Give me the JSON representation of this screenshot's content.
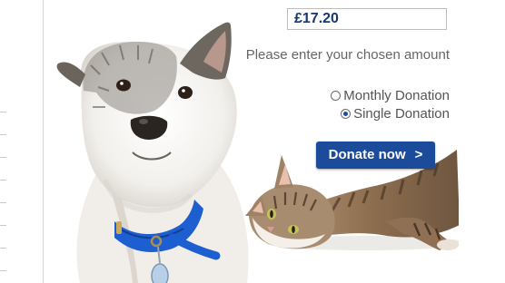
{
  "donation": {
    "amount": "£17.20",
    "prompt": "Please enter your chosen amount",
    "options": [
      {
        "label": "Monthly Donation",
        "selected": false
      },
      {
        "label": "Single Donation",
        "selected": true
      }
    ],
    "button_label": "Donate now",
    "button_icon": "chevron-right-icon"
  },
  "colors": {
    "amount_text": "#17376f",
    "button_bg": "#1b4b9a",
    "button_text": "#ffffff",
    "dog_collar": "#1d5fd1"
  }
}
